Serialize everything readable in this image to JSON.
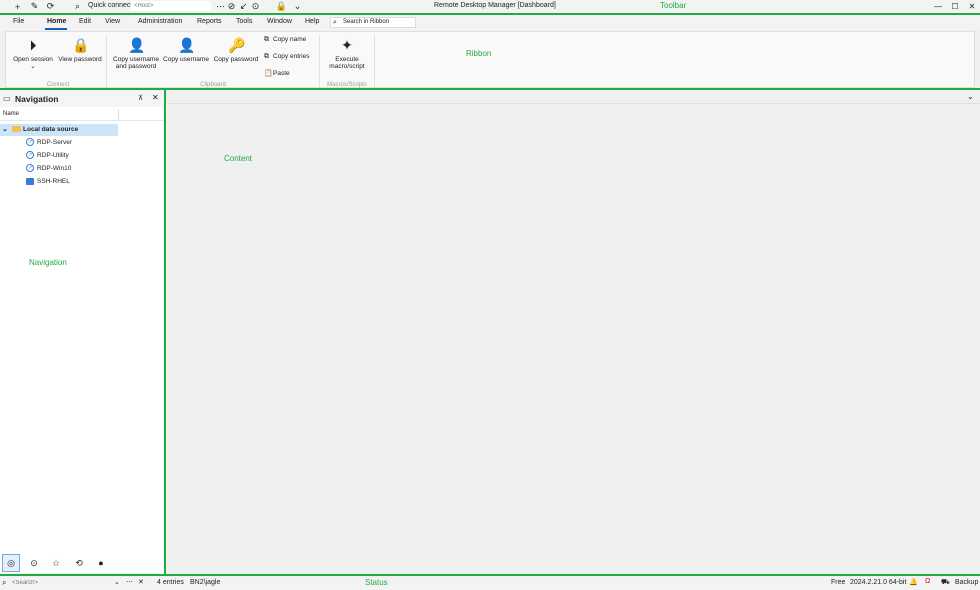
{
  "toolbar": {
    "quick_connect_label": "Quick connect",
    "host_placeholder": "<Host>",
    "window_title": "Remote Desktop Manager [Dashboard]",
    "region_label": "Toolbar"
  },
  "menu": {
    "items": [
      "File",
      "Home",
      "Edit",
      "View",
      "Administration",
      "Reports",
      "Tools",
      "Window",
      "Help"
    ],
    "search_placeholder": "Search in Ribbon"
  },
  "ribbon": {
    "region_label": "Ribbon",
    "connect": {
      "open_session": "Open session",
      "view_password": "View password",
      "group": "Connect"
    },
    "clipboard": {
      "copy_user_pass_line1": "Copy username",
      "copy_user_pass_line2": "and password",
      "copy_username": "Copy username",
      "copy_password": "Copy password",
      "copy_name": "Copy name",
      "copy_entries": "Copy entries",
      "paste": "Paste",
      "group": "Clipboard"
    },
    "macros": {
      "execute_line1": "Execute",
      "execute_line2": "macro/script",
      "group": "Macros/Scripts"
    }
  },
  "navigation": {
    "title": "Navigation",
    "column_name": "Name",
    "root": "Local data source",
    "entries": [
      "RDP-Server",
      "RDP-Utility",
      "RDP-Win10",
      "SSH-RHEL"
    ],
    "region_label": "Navigation"
  },
  "content": {
    "region_label": "Content"
  },
  "status": {
    "search_placeholder": "<Search>",
    "entries": "4 entries",
    "user": "BN2\\jagle",
    "region_label": "Status",
    "license": "Free",
    "version": "2024.2.21.0 64-bit",
    "backup": "Backup"
  },
  "colors": {
    "accent": "#1a5fb4",
    "region_outline": "#22aa44",
    "selection": "#cce4f7"
  }
}
